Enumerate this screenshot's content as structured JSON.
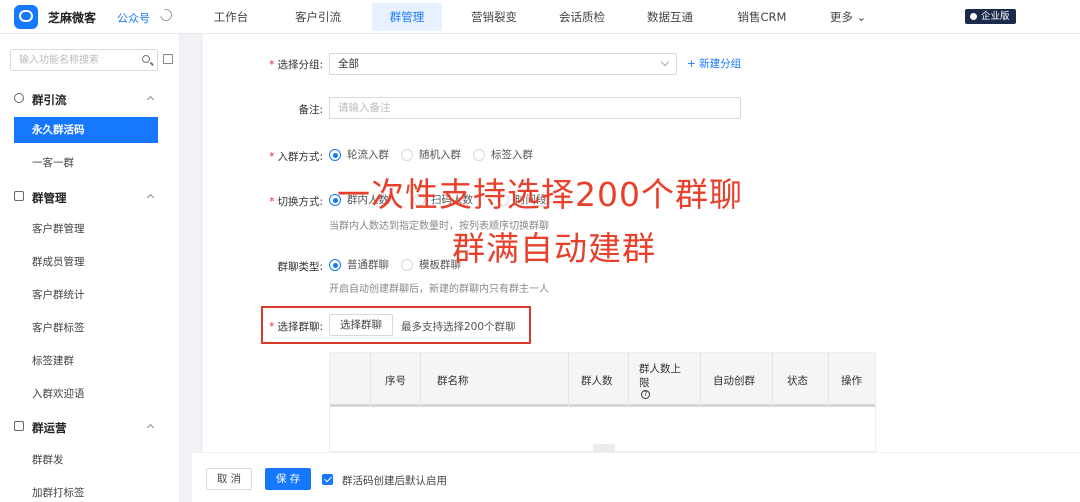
{
  "app": {
    "name": "芝麻微客",
    "sub_label": "公众号",
    "edition": "企业版"
  },
  "nav": {
    "items": [
      {
        "label": "工作台"
      },
      {
        "label": "客户引流"
      },
      {
        "label": "群管理",
        "active": true
      },
      {
        "label": "营销裂变"
      },
      {
        "label": "会话质检"
      },
      {
        "label": "数据互通"
      },
      {
        "label": "销售CRM"
      },
      {
        "label": "更多 ⌄"
      }
    ]
  },
  "sidebar": {
    "search_placeholder": "输入功能名称搜索",
    "groups": [
      {
        "title": "群引流",
        "items": [
          "永久群活码",
          "一客一群"
        ]
      },
      {
        "title": "群管理",
        "items": [
          "客户群管理",
          "群成员管理",
          "客户群统计",
          "客户群标签",
          "标签建群",
          "入群欢迎语"
        ]
      },
      {
        "title": "群运营",
        "items": [
          "群群发",
          "加群打标签"
        ]
      }
    ],
    "active_item": "永久群活码"
  },
  "form": {
    "group_select": {
      "label": "选择分组:",
      "value": "全部",
      "add_link": "+ 新建分组"
    },
    "remark": {
      "label": "备注:",
      "placeholder": "请输入备注"
    },
    "join_mode": {
      "label": "入群方式:",
      "options": [
        "轮流入群",
        "随机入群",
        "标签入群"
      ],
      "selected": 0
    },
    "switch_mode": {
      "label": "切换方式:",
      "options": [
        "群内人数",
        "扫码人数",
        "时间段"
      ],
      "selected": 0,
      "help": "当群内人数达到指定数量时，按列表顺序切换群聊"
    },
    "group_type": {
      "label": "群聊类型:",
      "options": [
        "普通群聊",
        "模板群聊"
      ],
      "selected": 0,
      "help": "开启自动创建群聊后，新建的群聊内只有群主一人"
    },
    "pick_group": {
      "label": "选择群聊:",
      "button": "选择群聊",
      "hint": "最多支持选择200个群聊"
    },
    "table_headers": [
      "",
      "序号",
      "群名称",
      "群人数",
      "群人数上限",
      "自动创群",
      "状态",
      "操作"
    ]
  },
  "overlay": {
    "line1": "一次性支持选择200个群聊",
    "line2": "群满自动建群"
  },
  "footer": {
    "cancel": "取 消",
    "save": "保 存",
    "checkbox_label": "群活码创建后默认启用",
    "checkbox_checked": true
  },
  "colors": {
    "accent": "#1677ff",
    "annotation": "#e8402b",
    "badge_bg": "#1b2a4a"
  }
}
